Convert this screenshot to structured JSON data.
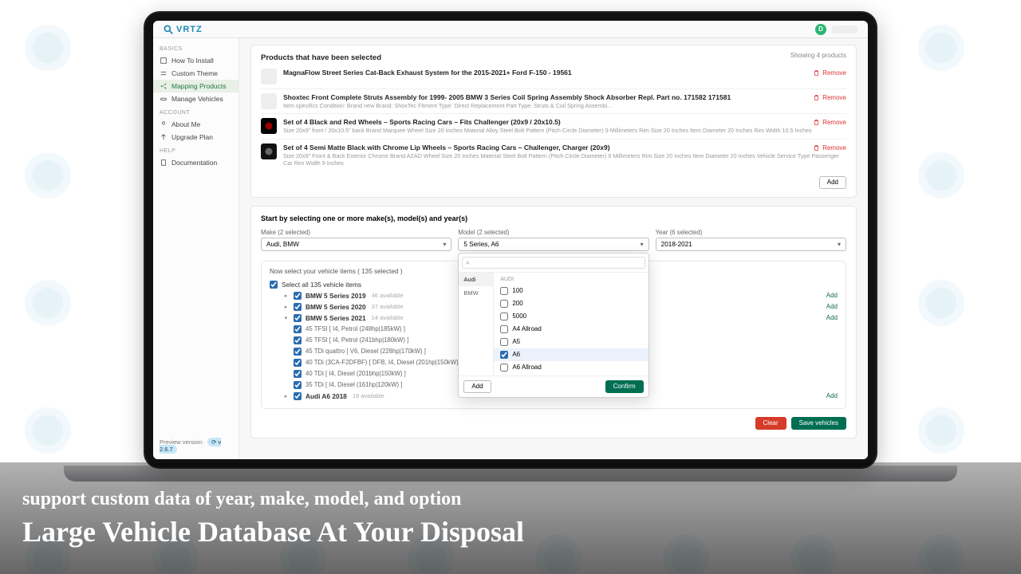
{
  "brand": "VRTZ",
  "avatar_initial": "D",
  "sidebar": {
    "sections": {
      "basics_label": "BASICS",
      "account_label": "ACCOUNT",
      "help_label": "HELP"
    },
    "items": {
      "install": "How To Install",
      "theme": "Custom Theme",
      "mapping": "Mapping Products",
      "manage": "Manage Vehicles",
      "about": "About Me",
      "upgrade": "Upgrade Plan",
      "docs": "Documentation"
    },
    "preview_label": "Preview version:",
    "preview_badge": "⟳ v 2.6.7"
  },
  "products_card": {
    "title": "Products that have been selected",
    "showing": "Showing 4 products",
    "add_label": "Add",
    "remove_label": "Remove",
    "rows": [
      {
        "title": "MagnaFlow Street Series Cat-Back Exhaust System for the 2015-2021+ Ford F-150 - 19561",
        "desc": ""
      },
      {
        "title": "Shoxtec Front Complete Struts Assembly for 1999- 2005 BMW 3 Series Coil Spring Assembly Shock Absorber Repl. Part no. 171582 171581",
        "desc": "Item specifics Condition: Brand new Brand: ShoxTec Fitment Type: Direct Replacement Part Type: Struts & Coil Spring Assembl..."
      },
      {
        "title": "Set of 4 Black and Red Wheels – Sports Racing Cars – Fits Challenger (20x9 / 20x10.5)",
        "desc": "Size 20x9\" front / 20x10.5\" back Brand Marquee Wheel Size 20 Inches Material Alloy Steel Bolt Pattern (Pitch Circle Diameter) 9 Millimeters Rim Size 20 Inches Item Diameter 20 Inches Rim Width 10.5 Inches"
      },
      {
        "title": "Set of 4 Semi Matte Black with Chrome Lip Wheels – Sports Racing Cars – Challenger, Charger (20x9)",
        "desc": "Size 20x9\" Front & Back Exterior Chrome Brand AZAD Wheel Size 20 Inches Material Steel Bolt Pattern (Pitch Circle Diameter) 9 Millimeters Rim Size 20 Inches Item Diameter 20 Inches Vehicle Service Type Passenger Car Rim Width 9 Inches"
      }
    ]
  },
  "selector": {
    "title": "Start by selecting one or more make(s), model(s) and year(s)",
    "make": {
      "label": "Make (2 selected)",
      "value": "Audi, BMW"
    },
    "model": {
      "label": "Model (2 selected)",
      "value": "5 Series, A6"
    },
    "year": {
      "label": "Year (6 selected)",
      "value": "2018-2021"
    }
  },
  "popover": {
    "tabs": {
      "audi": "Audi",
      "bmw": "BMW"
    },
    "header": "AUDI",
    "options": [
      "100",
      "200",
      "5000",
      "A4 Allroad",
      "A5",
      "A6",
      "A6 Allroad"
    ],
    "selected": "A6",
    "add": "Add",
    "confirm": "Confirm"
  },
  "vehicles": {
    "header": "Now select your vehicle items ( 135 selected )",
    "select_all": "Select all 135 vehicle items",
    "add_link": "Add",
    "groups": [
      {
        "label": "BMW 5 Series 2019",
        "avail": "46 available"
      },
      {
        "label": "BMW 5 Series 2020",
        "avail": "37 available"
      },
      {
        "label": "BMW 5 Series 2021",
        "avail": "14 available"
      },
      {
        "label": "Audi A6 2018",
        "avail": "18 available"
      }
    ],
    "engines": [
      "45 TFSI [ I4, Petrol (248hp|185kW) ]",
      "45 TFSI [ I4, Petrol (241bhp|180kW) ]",
      "45 TDi quattro [ V6, Diesel (228hp|170kW) ]",
      "40 TDi (3CA-F2DFBF) [ DFB, I4, Diesel (201hp|150kW) ]",
      "40 TDi [ I4, Diesel (201bhp|150kW) ]",
      "35 TDi [ I4, Diesel (161hp|120kW) ]"
    ]
  },
  "footer": {
    "clear": "Clear",
    "save": "Save vehicles"
  },
  "promo": {
    "tag": "support custom data of year, make, model, and option",
    "head": "Large Vehicle Database At Your Disposal"
  }
}
